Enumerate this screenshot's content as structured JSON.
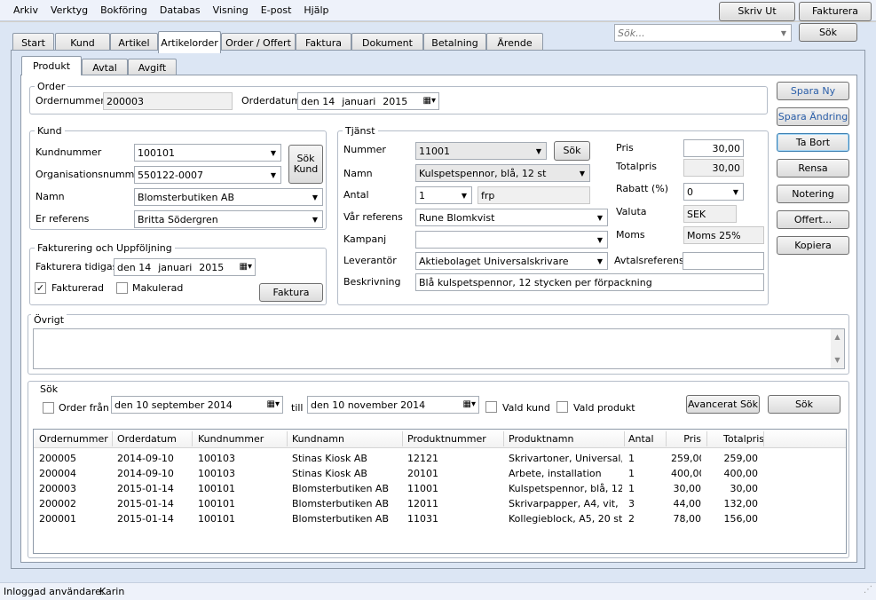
{
  "menu": [
    "Arkiv",
    "Verktyg",
    "Bokföring",
    "Databas",
    "Visning",
    "E-post",
    "Hjälp"
  ],
  "toolbar": {
    "print": "Skriv Ut",
    "invoice": "Fakturera",
    "search_placeholder": "Sök...",
    "search_button": "Sök"
  },
  "main_tabs": [
    "Start",
    "Kund",
    "Artikel",
    "Artikelorder",
    "Order / Offert",
    "Faktura",
    "Dokument",
    "Betalning",
    "Ärende"
  ],
  "sub_tabs": [
    "Produkt",
    "Avtal",
    "Avgift"
  ],
  "order": {
    "title": "Order",
    "number_label": "Ordernummer",
    "number": "200003",
    "date_label": "Orderdatum",
    "date_day": "den 14",
    "date_month": "januari",
    "date_year": "2015"
  },
  "customer": {
    "title": "Kund",
    "number_label": "Kundnummer",
    "number": "100101",
    "org_label": "Organisationsnummer",
    "org": "550122-0007",
    "name_label": "Namn",
    "name": "Blomsterbutiken AB",
    "ref_label": "Er referens",
    "ref": "Britta Södergren",
    "search_line1": "Sök",
    "search_line2": "Kund"
  },
  "billing": {
    "title": "Fakturering och Uppföljning",
    "earliest_label": "Fakturera tidigast",
    "day": "den 14",
    "month": "januari",
    "year": "2015",
    "invoiced_label": "Fakturerad",
    "invoiced": "✓",
    "cancelled_label": "Makulerad",
    "invoice_button": "Faktura"
  },
  "service": {
    "title": "Tjänst",
    "number_label": "Nummer",
    "number": "11001",
    "search": "Sök",
    "name_label": "Namn",
    "name": "Kulspetspennor, blå, 12 st",
    "qty_label": "Antal",
    "qty": "1",
    "unit": "frp",
    "ourref_label": "Vår referens",
    "ourref": "Rune Blomkvist",
    "campaign_label": "Kampanj",
    "campaign": "",
    "supplier_label": "Leverantör",
    "supplier": "Aktiebolaget Universalskrivare",
    "desc_label": "Beskrivning",
    "desc": "Blå kulspetspennor, 12 stycken per förpackning",
    "price_label": "Pris",
    "price": "30,00",
    "total_label": "Totalpris",
    "total": "30,00",
    "discount_label": "Rabatt (%)",
    "discount": "0",
    "currency_label": "Valuta",
    "currency": "SEK",
    "vat_label": "Moms",
    "vat": "Moms 25%",
    "agreement_label": "Avtalsreferens",
    "agreement": ""
  },
  "side_buttons": [
    "Spara Ny",
    "Spara Ändring",
    "Ta Bort",
    "Rensa",
    "Notering",
    "Offert...",
    "Kopiera"
  ],
  "other": {
    "title": "Övrigt"
  },
  "search": {
    "title": "Sök",
    "from_label": "Order från",
    "from": "den 10 september 2014",
    "to_label": "till",
    "to": "den 10 november 2014",
    "sel_customer": "Vald kund",
    "sel_product": "Vald produkt",
    "advanced": "Avancerat Sök",
    "search": "Sök"
  },
  "table": {
    "headers": [
      "Ordernummer",
      "Orderdatum",
      "Kundnummer",
      "Kundnamn",
      "Produktnummer",
      "Produktnamn",
      "Antal",
      "Pris",
      "Totalpris"
    ],
    "rows": [
      [
        "200005",
        "2014-09-10",
        "100103",
        "Stinas Kiosk AB",
        "12121",
        "Skrivartoner, Universal, ...",
        "1",
        "259,00",
        "259,00"
      ],
      [
        "200004",
        "2014-09-10",
        "100103",
        "Stinas Kiosk AB",
        "20101",
        "Arbete, installation",
        "1",
        "400,00",
        "400,00"
      ],
      [
        "200003",
        "2015-01-14",
        "100101",
        "Blomsterbutiken AB",
        "11001",
        "Kulspetspennor, blå, 12 st",
        "1",
        "30,00",
        "30,00"
      ],
      [
        "200002",
        "2015-01-14",
        "100101",
        "Blomsterbutiken AB",
        "12011",
        "Skrivarpapper, A4, vit, 5...",
        "3",
        "44,00",
        "132,00"
      ],
      [
        "200001",
        "2015-01-14",
        "100101",
        "Blomsterbutiken AB",
        "11031",
        "Kollegieblock, A5, 20 st",
        "2",
        "78,00",
        "156,00"
      ]
    ]
  },
  "status": {
    "label": "Inloggad användare:",
    "user": "Karin"
  }
}
